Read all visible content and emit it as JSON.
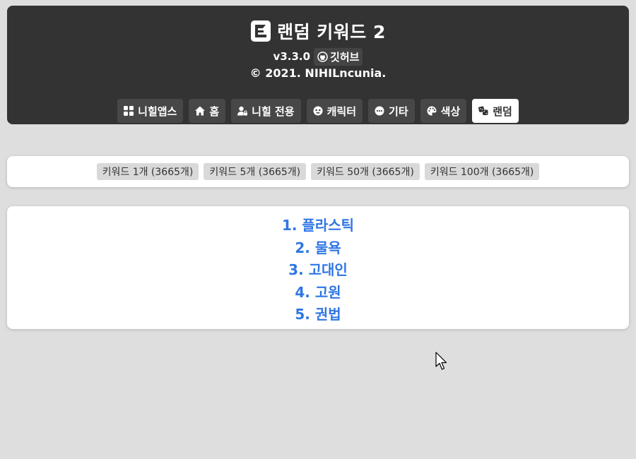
{
  "header": {
    "title": "랜덤 키워드 2",
    "version": "v3.3.0",
    "github_label": "깃허브",
    "copyright": "© 2021. NIHILncunia."
  },
  "nav": {
    "items": [
      {
        "label": "니힐앱스",
        "icon": "grid-icon"
      },
      {
        "label": "홈",
        "icon": "home-icon"
      },
      {
        "label": "니힐 전용",
        "icon": "user-lock-icon"
      },
      {
        "label": "캐릭터",
        "icon": "face-icon"
      },
      {
        "label": "기타",
        "icon": "ellipsis-icon"
      },
      {
        "label": "색상",
        "icon": "palette-icon"
      },
      {
        "label": "랜덤",
        "icon": "dice-icon",
        "active": true
      }
    ]
  },
  "options": {
    "buttons": [
      {
        "label": "키워드 1개 (3665개)"
      },
      {
        "label": "키워드 5개 (3665개)"
      },
      {
        "label": "키워드 50개 (3665개)"
      },
      {
        "label": "키워드 100개 (3665개)"
      }
    ]
  },
  "results": {
    "items": [
      "1. 플라스틱",
      "2. 물욕",
      "3. 고대인",
      "4. 고원",
      "5. 권법"
    ]
  },
  "colors": {
    "header_bg": "#333333",
    "page_bg": "#dedede",
    "result_text": "#2f76e4"
  }
}
